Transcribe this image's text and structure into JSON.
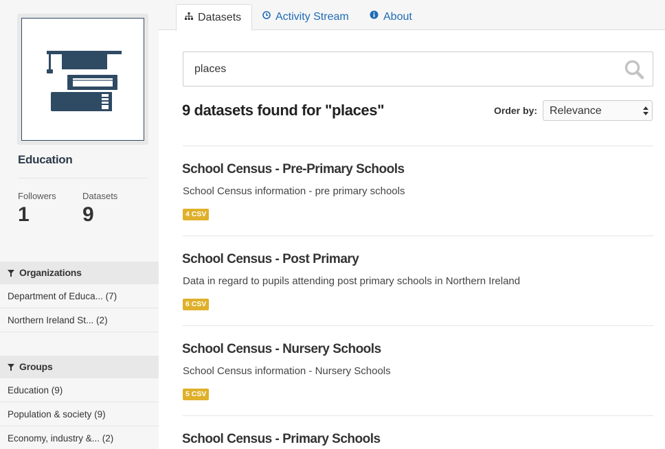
{
  "tabs": [
    {
      "label": "Datasets",
      "icon": "sitemap-icon",
      "active": true
    },
    {
      "label": "Activity Stream",
      "icon": "clock-icon",
      "active": false
    },
    {
      "label": "About",
      "icon": "info-icon",
      "active": false
    }
  ],
  "group": {
    "name": "Education",
    "image_icon": "education-books-icon",
    "followers_label": "Followers",
    "followers": "1",
    "datasets_label": "Datasets",
    "datasets": "9"
  },
  "facets": {
    "organizations": {
      "title": "Organizations",
      "items": [
        "Department of Educa... (7)",
        "Northern Ireland St... (2)"
      ]
    },
    "groups": {
      "title": "Groups",
      "items": [
        "Education (9)",
        "Population & society (9)",
        "Economy, industry &... (2)"
      ]
    }
  },
  "search": {
    "value": "places",
    "button_icon": "search-icon"
  },
  "results": {
    "title": "9 datasets found for \"places\"",
    "order_label": "Order by:",
    "order_value": "Relevance"
  },
  "datasets": [
    {
      "title": "School Census - Pre-Primary Schools",
      "description": "School Census information - pre primary schools",
      "badge": "4 CSV"
    },
    {
      "title": "School Census - Post Primary",
      "description": "Data in regard to pupils attending post primary schools in Northern Ireland",
      "badge": "6 CSV"
    },
    {
      "title": "School Census - Nursery Schools",
      "description": "School Census information - Nursery Schools",
      "badge": "5 CSV"
    },
    {
      "title": "School Census - Primary Schools",
      "description": "",
      "badge": ""
    }
  ],
  "colors": {
    "link": "#1f6bb5",
    "badge": "#dfb02a",
    "icon_dark": "#2f4a63"
  }
}
